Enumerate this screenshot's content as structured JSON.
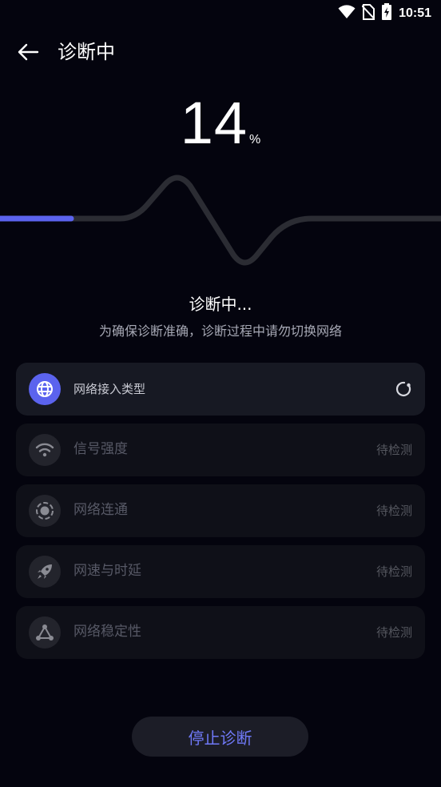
{
  "status_bar": {
    "time": "10:51",
    "icons": [
      "wifi-icon",
      "no-sim-icon",
      "battery-charging-icon"
    ]
  },
  "header": {
    "back_icon": "arrow-left-icon",
    "title": "诊断中"
  },
  "progress": {
    "value": "14",
    "unit": "%",
    "fraction": 0.14
  },
  "colors": {
    "accent": "#5b63ee",
    "background": "#04040e",
    "card": "#0f1018",
    "card_active": "#171923",
    "button_text": "#6f79f7"
  },
  "status": {
    "title": "诊断中...",
    "subtitle": "为确保诊断准确，诊断过程中请勿切换网络"
  },
  "checks": [
    {
      "label": "网络接入类型",
      "icon": "globe-icon",
      "state": "running",
      "status": ""
    },
    {
      "label": "信号强度",
      "icon": "wifi-signal-icon",
      "state": "pending",
      "status": "待检测"
    },
    {
      "label": "网络连通",
      "icon": "radar-icon",
      "state": "pending",
      "status": "待检测"
    },
    {
      "label": "网速与时延",
      "icon": "rocket-icon",
      "state": "pending",
      "status": "待检测"
    },
    {
      "label": "网络稳定性",
      "icon": "nodes-icon",
      "state": "pending",
      "status": "待检测"
    }
  ],
  "stop_button": {
    "label": "停止诊断"
  }
}
